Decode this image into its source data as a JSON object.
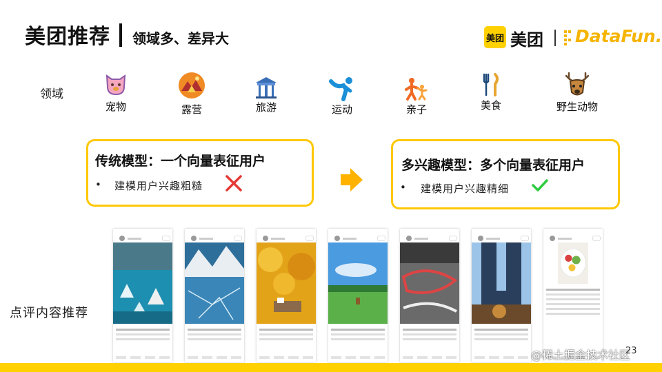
{
  "header": {
    "title": "美团推荐",
    "subtitle": "领域多、差异大"
  },
  "logos": {
    "badge_text": "美团",
    "brand_text": "美团",
    "partner_text": "DataFun."
  },
  "domains": {
    "label": "领域",
    "items": [
      {
        "label": "宠物",
        "icon": "pet-icon"
      },
      {
        "label": "露营",
        "icon": "camping-icon"
      },
      {
        "label": "旅游",
        "icon": "travel-icon"
      },
      {
        "label": "运动",
        "icon": "sports-icon"
      },
      {
        "label": "亲子",
        "icon": "parent-child-icon"
      },
      {
        "label": "美食",
        "icon": "food-icon"
      },
      {
        "label": "野生动物",
        "icon": "wildlife-icon"
      }
    ]
  },
  "comparison": {
    "left": {
      "title": "传统模型：一个向量表征用户",
      "bullet": "•",
      "item": "建模用户兴趣粗糙",
      "mark": "cross-icon"
    },
    "arrow": "arrow-right-icon",
    "right": {
      "title": "多兴趣模型：多个向量表征用户",
      "bullet": "•",
      "item": "建模用户兴趣精细",
      "mark": "check-icon"
    }
  },
  "review": {
    "label": "点评内容推荐"
  },
  "footer": {
    "page_number": "23",
    "watermark": "@稀土掘金技术社区"
  },
  "colors": {
    "accent": "#ffc800",
    "brand_yellow": "#ffd100",
    "cross": "#e53935",
    "check": "#2ecc40",
    "arrow": "#ffb300"
  }
}
